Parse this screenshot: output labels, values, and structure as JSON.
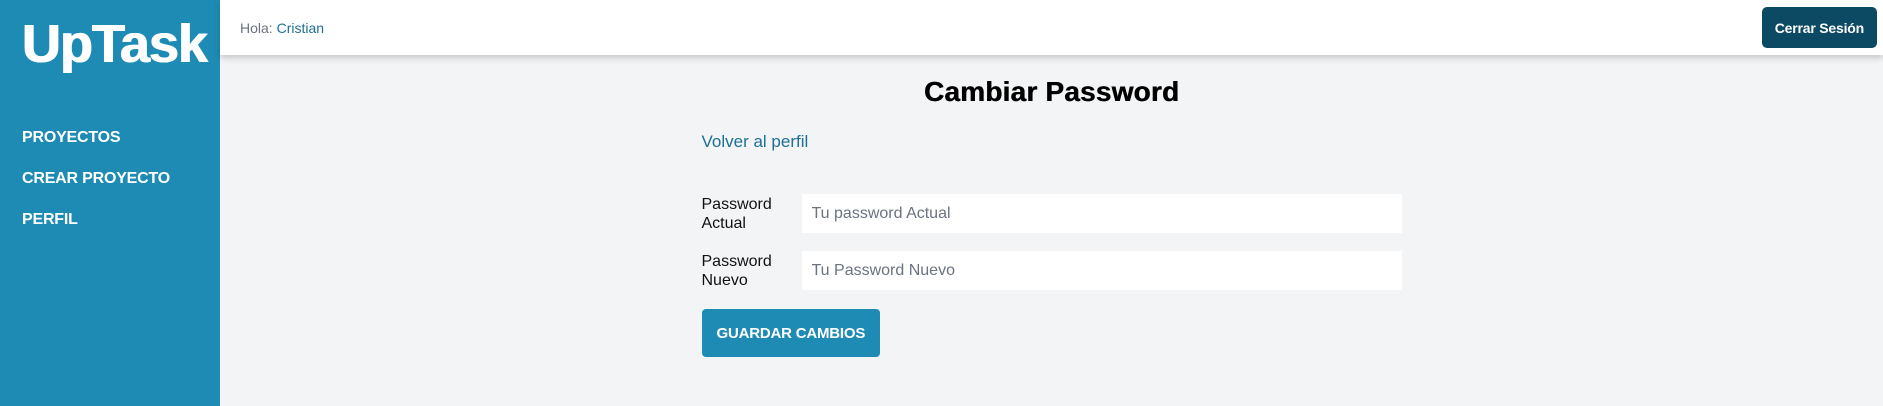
{
  "sidebar": {
    "brand": "UpTask",
    "items": [
      {
        "label": "PROYECTOS"
      },
      {
        "label": "CREAR PROYECTO"
      },
      {
        "label": "PERFIL"
      }
    ]
  },
  "header": {
    "greeting_prefix": "Hola: ",
    "user_name": "Cristian",
    "logout_label": "Cerrar Sesión"
  },
  "main": {
    "title": "Cambiar Password",
    "back_link": "Volver al perfil",
    "form": {
      "current_password": {
        "label_line1": "Password",
        "label_line2": "Actual",
        "placeholder": "Tu password Actual"
      },
      "new_password": {
        "label_line1": "Password",
        "label_line2": "Nuevo",
        "placeholder": "Tu Password Nuevo"
      },
      "submit_label": "GUARDAR CAMBIOS"
    }
  },
  "colors": {
    "sidebar_bg": "#1e8bb4",
    "logout_bg": "#0c4a63",
    "link": "#1e6f94",
    "page_bg": "#f3f4f6"
  }
}
